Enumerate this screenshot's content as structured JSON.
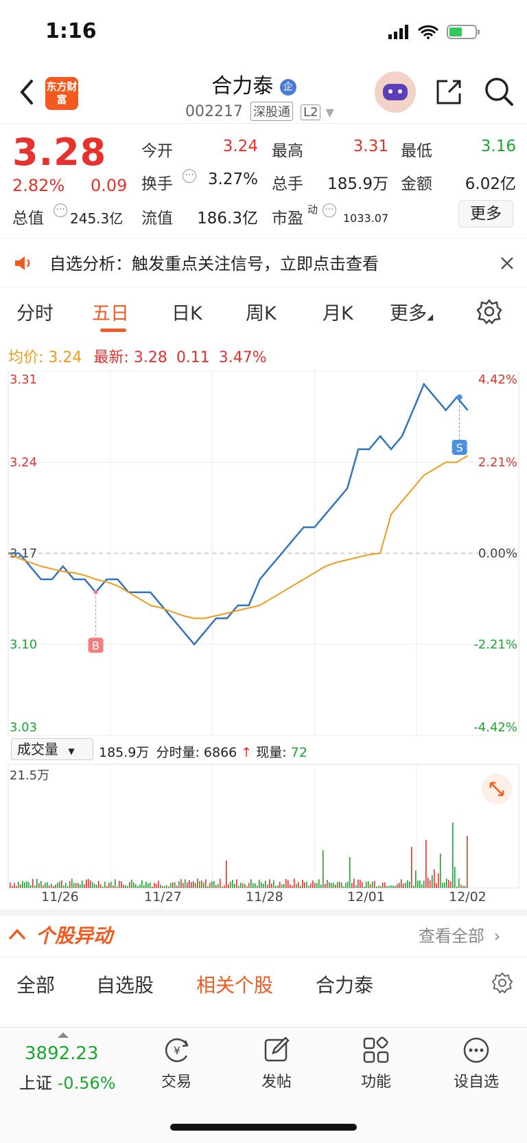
{
  "status": {
    "time": "1:16"
  },
  "header": {
    "logo_text": "东方财富",
    "stock_name": "合力泰",
    "stock_code": "002217",
    "tag1": "深股通",
    "tag2": "L2"
  },
  "quote": {
    "price": "3.28",
    "change_pct": "2.82%",
    "change_amt": "0.09",
    "open_label": "今开",
    "open": "3.24",
    "high_label": "最高",
    "high": "3.31",
    "low_label": "最低",
    "low": "3.16",
    "turnover_label": "换手",
    "turnover": "3.27%",
    "volume_label": "总手",
    "volume": "185.9万",
    "amount_label": "金额",
    "amount": "6.02亿",
    "mcap_label": "总值",
    "mcap": "245.3亿",
    "float_label": "流值",
    "float": "186.3亿",
    "pe_label": "市盈",
    "pe_sup": "动",
    "pe": "1033.07",
    "more": "更多"
  },
  "alert": {
    "text": "自选分析：触发重点关注信号，立即点击查看"
  },
  "tabs": [
    "分时",
    "五日",
    "日K",
    "周K",
    "月K",
    "更多"
  ],
  "chart_legend": {
    "avg_label": "均价:",
    "avg": "3.24",
    "latest_label": "最新:",
    "latest": "3.28",
    "chg": "0.11",
    "pct": "3.47%"
  },
  "chart_data": {
    "type": "line",
    "x": [
      "11/26",
      "11/27",
      "11/28",
      "12/01",
      "12/02"
    ],
    "y_left_ticks": [
      "3.31",
      "3.24",
      "3.17",
      "3.10",
      "3.03"
    ],
    "y_right_ticks": [
      "4.42%",
      "2.21%",
      "0.00%",
      "-2.21%",
      "-4.42%"
    ],
    "ylim": [
      3.03,
      3.31
    ],
    "prev_close": 3.17,
    "series": [
      {
        "values": [
          3.17,
          3.17,
          3.16,
          3.15,
          3.15,
          3.16,
          3.15,
          3.15,
          3.14,
          3.15,
          3.15,
          3.14,
          3.14,
          3.14,
          3.13,
          3.12,
          3.11,
          3.1,
          3.11,
          3.12,
          3.12,
          3.13,
          3.13,
          3.15,
          3.16,
          3.17,
          3.18,
          3.19,
          3.19,
          3.2,
          3.21,
          3.22,
          3.25,
          3.25,
          3.26,
          3.25,
          3.26,
          3.28,
          3.3,
          3.29,
          3.28,
          3.29,
          3.28
        ]
      },
      {
        "values": [
          3.17,
          3.166,
          3.163,
          3.16,
          3.158,
          3.156,
          3.155,
          3.153,
          3.15,
          3.148,
          3.145,
          3.14,
          3.135,
          3.13,
          3.128,
          3.125,
          3.122,
          3.12,
          3.12,
          3.122,
          3.124,
          3.126,
          3.128,
          3.13,
          3.135,
          3.14,
          3.145,
          3.15,
          3.155,
          3.16,
          3.163,
          3.165,
          3.167,
          3.169,
          3.17,
          3.2,
          3.21,
          3.22,
          3.23,
          3.235,
          3.24,
          3.24,
          3.245
        ]
      }
    ],
    "markers": {
      "buy": "B",
      "sell": "S"
    }
  },
  "volume": {
    "selector": "成交量",
    "total": "185.9万",
    "minute_label": "分时量:",
    "minute": "6866",
    "now_label": "现量:",
    "now": "72",
    "max_label": "21.5万"
  },
  "section": {
    "title": "个股异动",
    "link": "查看全部",
    "sub_tabs": [
      "全部",
      "自选股",
      "相关个股",
      "合力泰"
    ]
  },
  "bottom": {
    "index_value": "3892.23",
    "index_name": "上证",
    "index_pct": "-0.56%",
    "nav": [
      "交易",
      "发帖",
      "功能",
      "设自选"
    ]
  },
  "colors": {
    "up": "#e8302c",
    "down": "#17a82e",
    "accent": "#f25a1f",
    "line": "#2f74c0",
    "avg": "#f39a16"
  }
}
